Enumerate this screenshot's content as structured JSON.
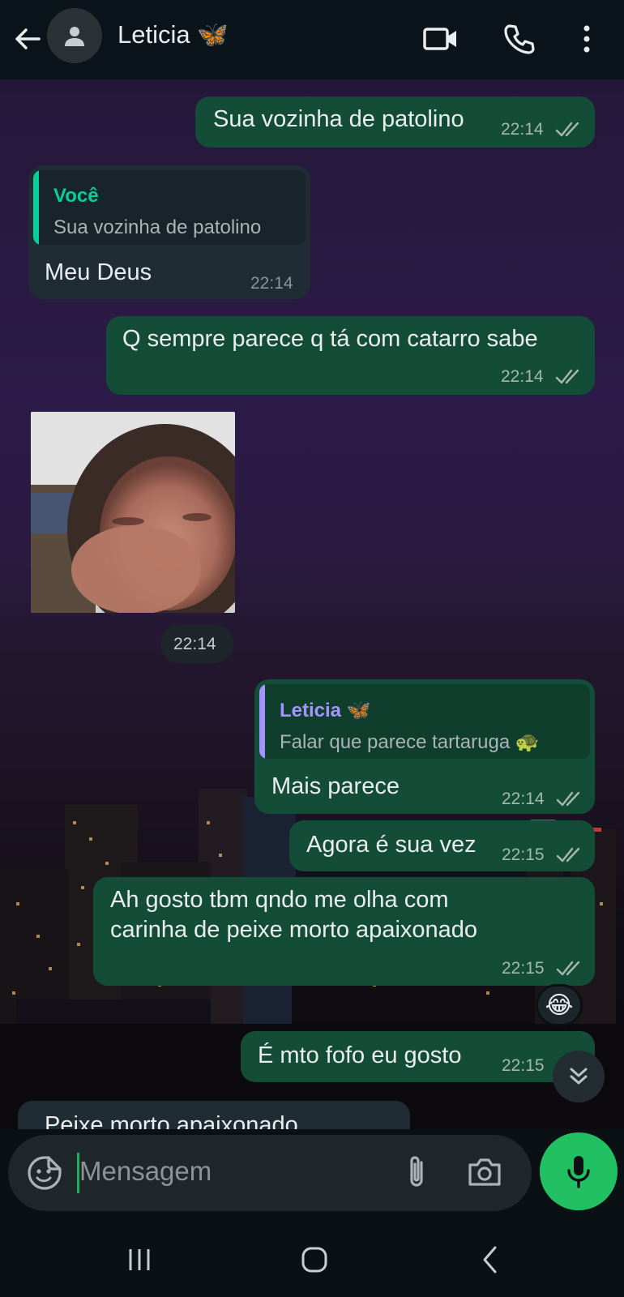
{
  "header": {
    "contact_name": "Leticia 🦋",
    "icons": [
      "back-arrow-icon",
      "avatar-icon",
      "video-call-icon",
      "voice-call-icon",
      "more-options-icon"
    ]
  },
  "messages": [
    {
      "direction": "out",
      "text": "Sua vozinha de patolino",
      "time": "22:14",
      "status": "read"
    },
    {
      "direction": "in",
      "quote_author": "Você",
      "quote_text": "Sua vozinha de patolino",
      "text": "Meu Deus",
      "time": "22:14"
    },
    {
      "direction": "out",
      "text": "Q sempre parece q tá com catarro sabe",
      "time": "22:14",
      "status": "read"
    },
    {
      "direction": "in",
      "type": "photo",
      "time": "22:14"
    },
    {
      "direction": "out",
      "quote_author": "Leticia 🦋",
      "quote_text": "Falar que parece tartaruga 🐢",
      "text": "Mais parece",
      "time": "22:14",
      "status": "read"
    },
    {
      "direction": "out",
      "text": "Agora é sua vez",
      "time": "22:15",
      "status": "read"
    },
    {
      "direction": "out",
      "text": "Ah gosto tbm qndo me olha com\ncarinha de peixe morto apaixonado",
      "time": "22:15",
      "status": "read",
      "reaction": "😂"
    },
    {
      "direction": "out",
      "text": "É mto fofo eu gosto",
      "time": "22:15",
      "status": "read"
    },
    {
      "direction": "in",
      "text": "Peixe morto apaixonado",
      "time": ""
    }
  ],
  "composer": {
    "placeholder": "Mensagem",
    "icons": [
      "sticker-icon",
      "attach-icon",
      "camera-icon",
      "mic-icon"
    ]
  },
  "navbar": {
    "icons": [
      "recent-apps-icon",
      "home-icon",
      "back-icon"
    ]
  },
  "colors": {
    "outgoing_bubble": "#144d37",
    "incoming_bubble": "#1f2c33",
    "accent_green": "#21c063",
    "quote_you": "#06cf9c",
    "quote_leticia": "#a593ff"
  }
}
